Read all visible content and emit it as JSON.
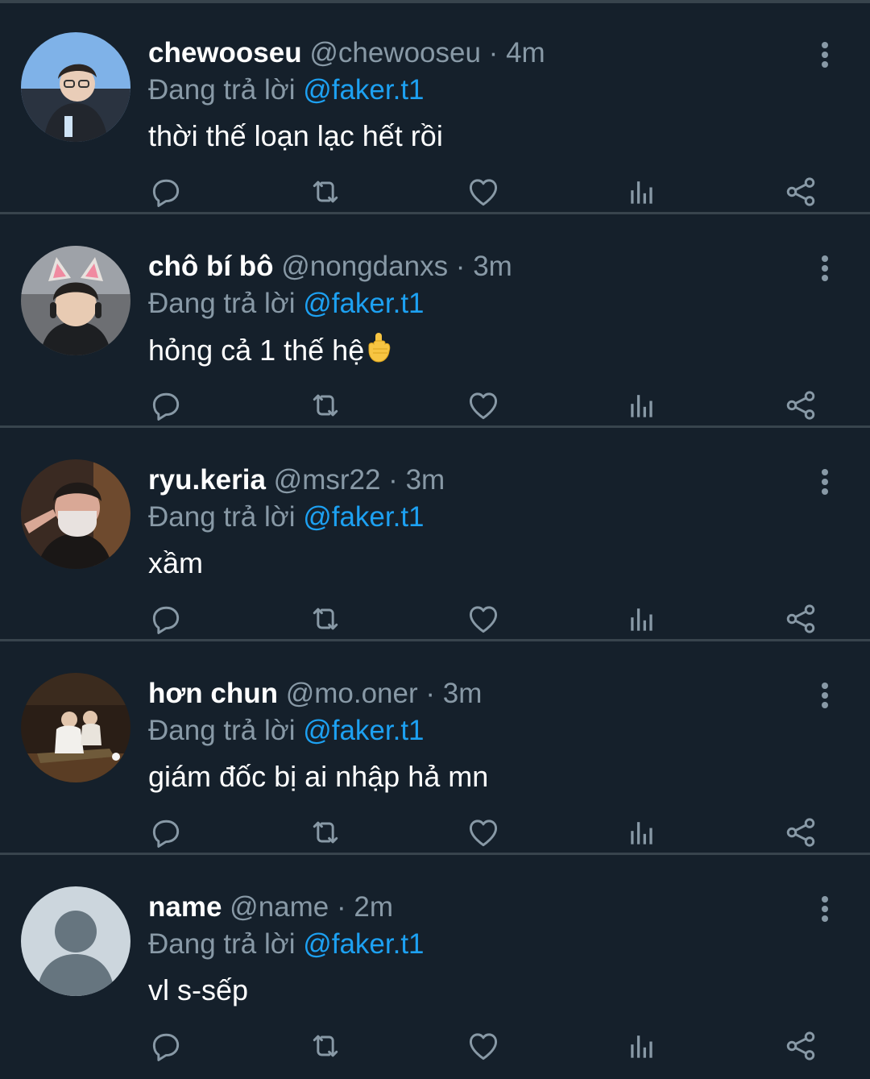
{
  "reply_prefix": "Đang trả lời",
  "colors": {
    "background": "#15202b",
    "divider": "#38444d",
    "secondary_text": "#8899a6",
    "accent": "#1da1f2"
  },
  "icons": {
    "reply": "comment-bubble-icon",
    "retweet": "retweet-icon",
    "like": "heart-icon",
    "views": "bar-chart-icon",
    "share": "share-icon",
    "more": "more-vertical-icon"
  },
  "tweets": [
    {
      "name": "chewooseu",
      "handle": "@chewooseu",
      "time": "4m",
      "mention": "@faker.t1",
      "text": "thời thế loạn lạc hết rồi"
    },
    {
      "name": "chô bí bô",
      "handle": "@nongdanxs",
      "time": "3m",
      "mention": "@faker.t1",
      "text": "hỏng cả 1 thế hệ"
    },
    {
      "name": "ryu.keria",
      "handle": "@msr22",
      "time": "3m",
      "mention": "@faker.t1",
      "text": "xầm"
    },
    {
      "name": "hơn chun",
      "handle": "@mo.oner",
      "time": "3m",
      "mention": "@faker.t1",
      "text": "giám đốc bị ai nhập hả mn"
    },
    {
      "name": "name",
      "handle": "@name",
      "time": "2m",
      "mention": "@faker.t1",
      "text": "vl s-sếp"
    }
  ]
}
